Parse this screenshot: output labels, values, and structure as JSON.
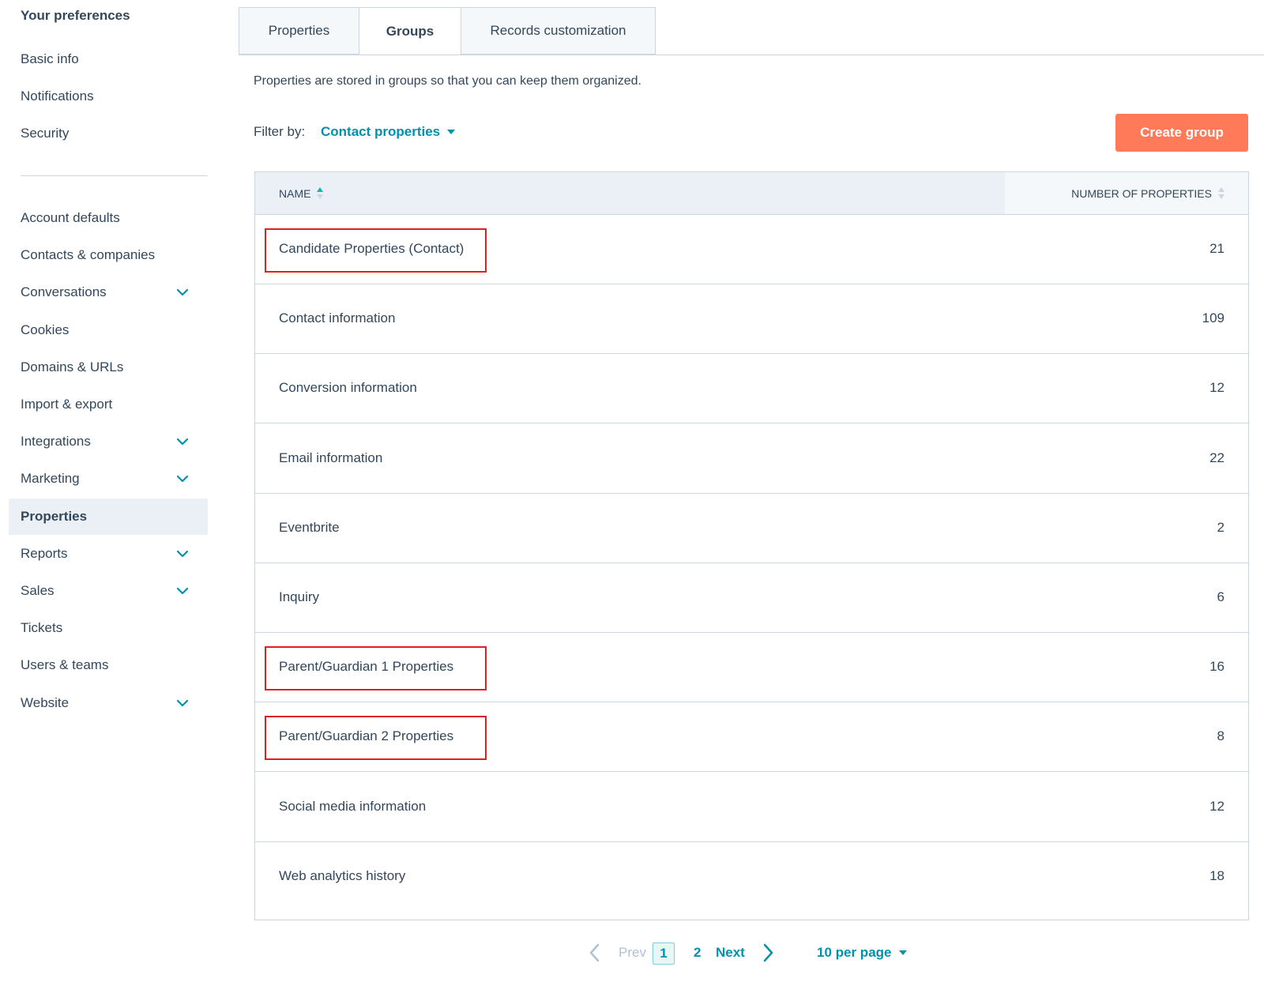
{
  "sidebar": {
    "heading": "Your preferences",
    "top_items": [
      {
        "label": "Basic info"
      },
      {
        "label": "Notifications"
      },
      {
        "label": "Security"
      }
    ],
    "items": [
      {
        "label": "Account defaults",
        "expandable": false
      },
      {
        "label": "Contacts & companies",
        "expandable": false
      },
      {
        "label": "Conversations",
        "expandable": true
      },
      {
        "label": "Cookies",
        "expandable": false
      },
      {
        "label": "Domains & URLs",
        "expandable": false
      },
      {
        "label": "Import & export",
        "expandable": false
      },
      {
        "label": "Integrations",
        "expandable": true
      },
      {
        "label": "Marketing",
        "expandable": true
      },
      {
        "label": "Properties",
        "expandable": false,
        "active": true
      },
      {
        "label": "Reports",
        "expandable": true
      },
      {
        "label": "Sales",
        "expandable": true
      },
      {
        "label": "Tickets",
        "expandable": false
      },
      {
        "label": "Users & teams",
        "expandable": false
      },
      {
        "label": "Website",
        "expandable": true
      }
    ]
  },
  "tabs": [
    {
      "label": "Properties"
    },
    {
      "label": "Groups",
      "active": true
    },
    {
      "label": "Records customization"
    }
  ],
  "description": "Properties are stored in groups so that you can keep them organized.",
  "filter": {
    "label": "Filter by:",
    "value": "Contact properties"
  },
  "create_button": "Create group",
  "table": {
    "columns": {
      "name": "NAME",
      "count": "NUMBER OF PROPERTIES"
    },
    "rows": [
      {
        "name": "Candidate Properties (Contact)",
        "count": "21",
        "highlighted": true
      },
      {
        "name": "Contact information",
        "count": "109"
      },
      {
        "name": "Conversion information",
        "count": "12"
      },
      {
        "name": "Email information",
        "count": "22"
      },
      {
        "name": "Eventbrite",
        "count": "2"
      },
      {
        "name": "Inquiry",
        "count": "6"
      },
      {
        "name": "Parent/Guardian 1 Properties",
        "count": "16",
        "highlighted": true
      },
      {
        "name": "Parent/Guardian 2 Properties",
        "count": "8",
        "highlighted": true
      },
      {
        "name": "Social media information",
        "count": "12"
      },
      {
        "name": "Web analytics history",
        "count": "18"
      }
    ]
  },
  "pagination": {
    "prev": "Prev",
    "current": "1",
    "page2": "2",
    "next": "Next",
    "per_page": "10 per page"
  },
  "colors": {
    "accent": "#0091ae",
    "button": "#ff7a59",
    "highlight": "#e02020",
    "text": "#33475b"
  },
  "icons": {
    "chevron": "chevron-down-icon",
    "sort": "sort-icon",
    "prev": "chevron-left-icon",
    "next": "chevron-right-icon"
  }
}
